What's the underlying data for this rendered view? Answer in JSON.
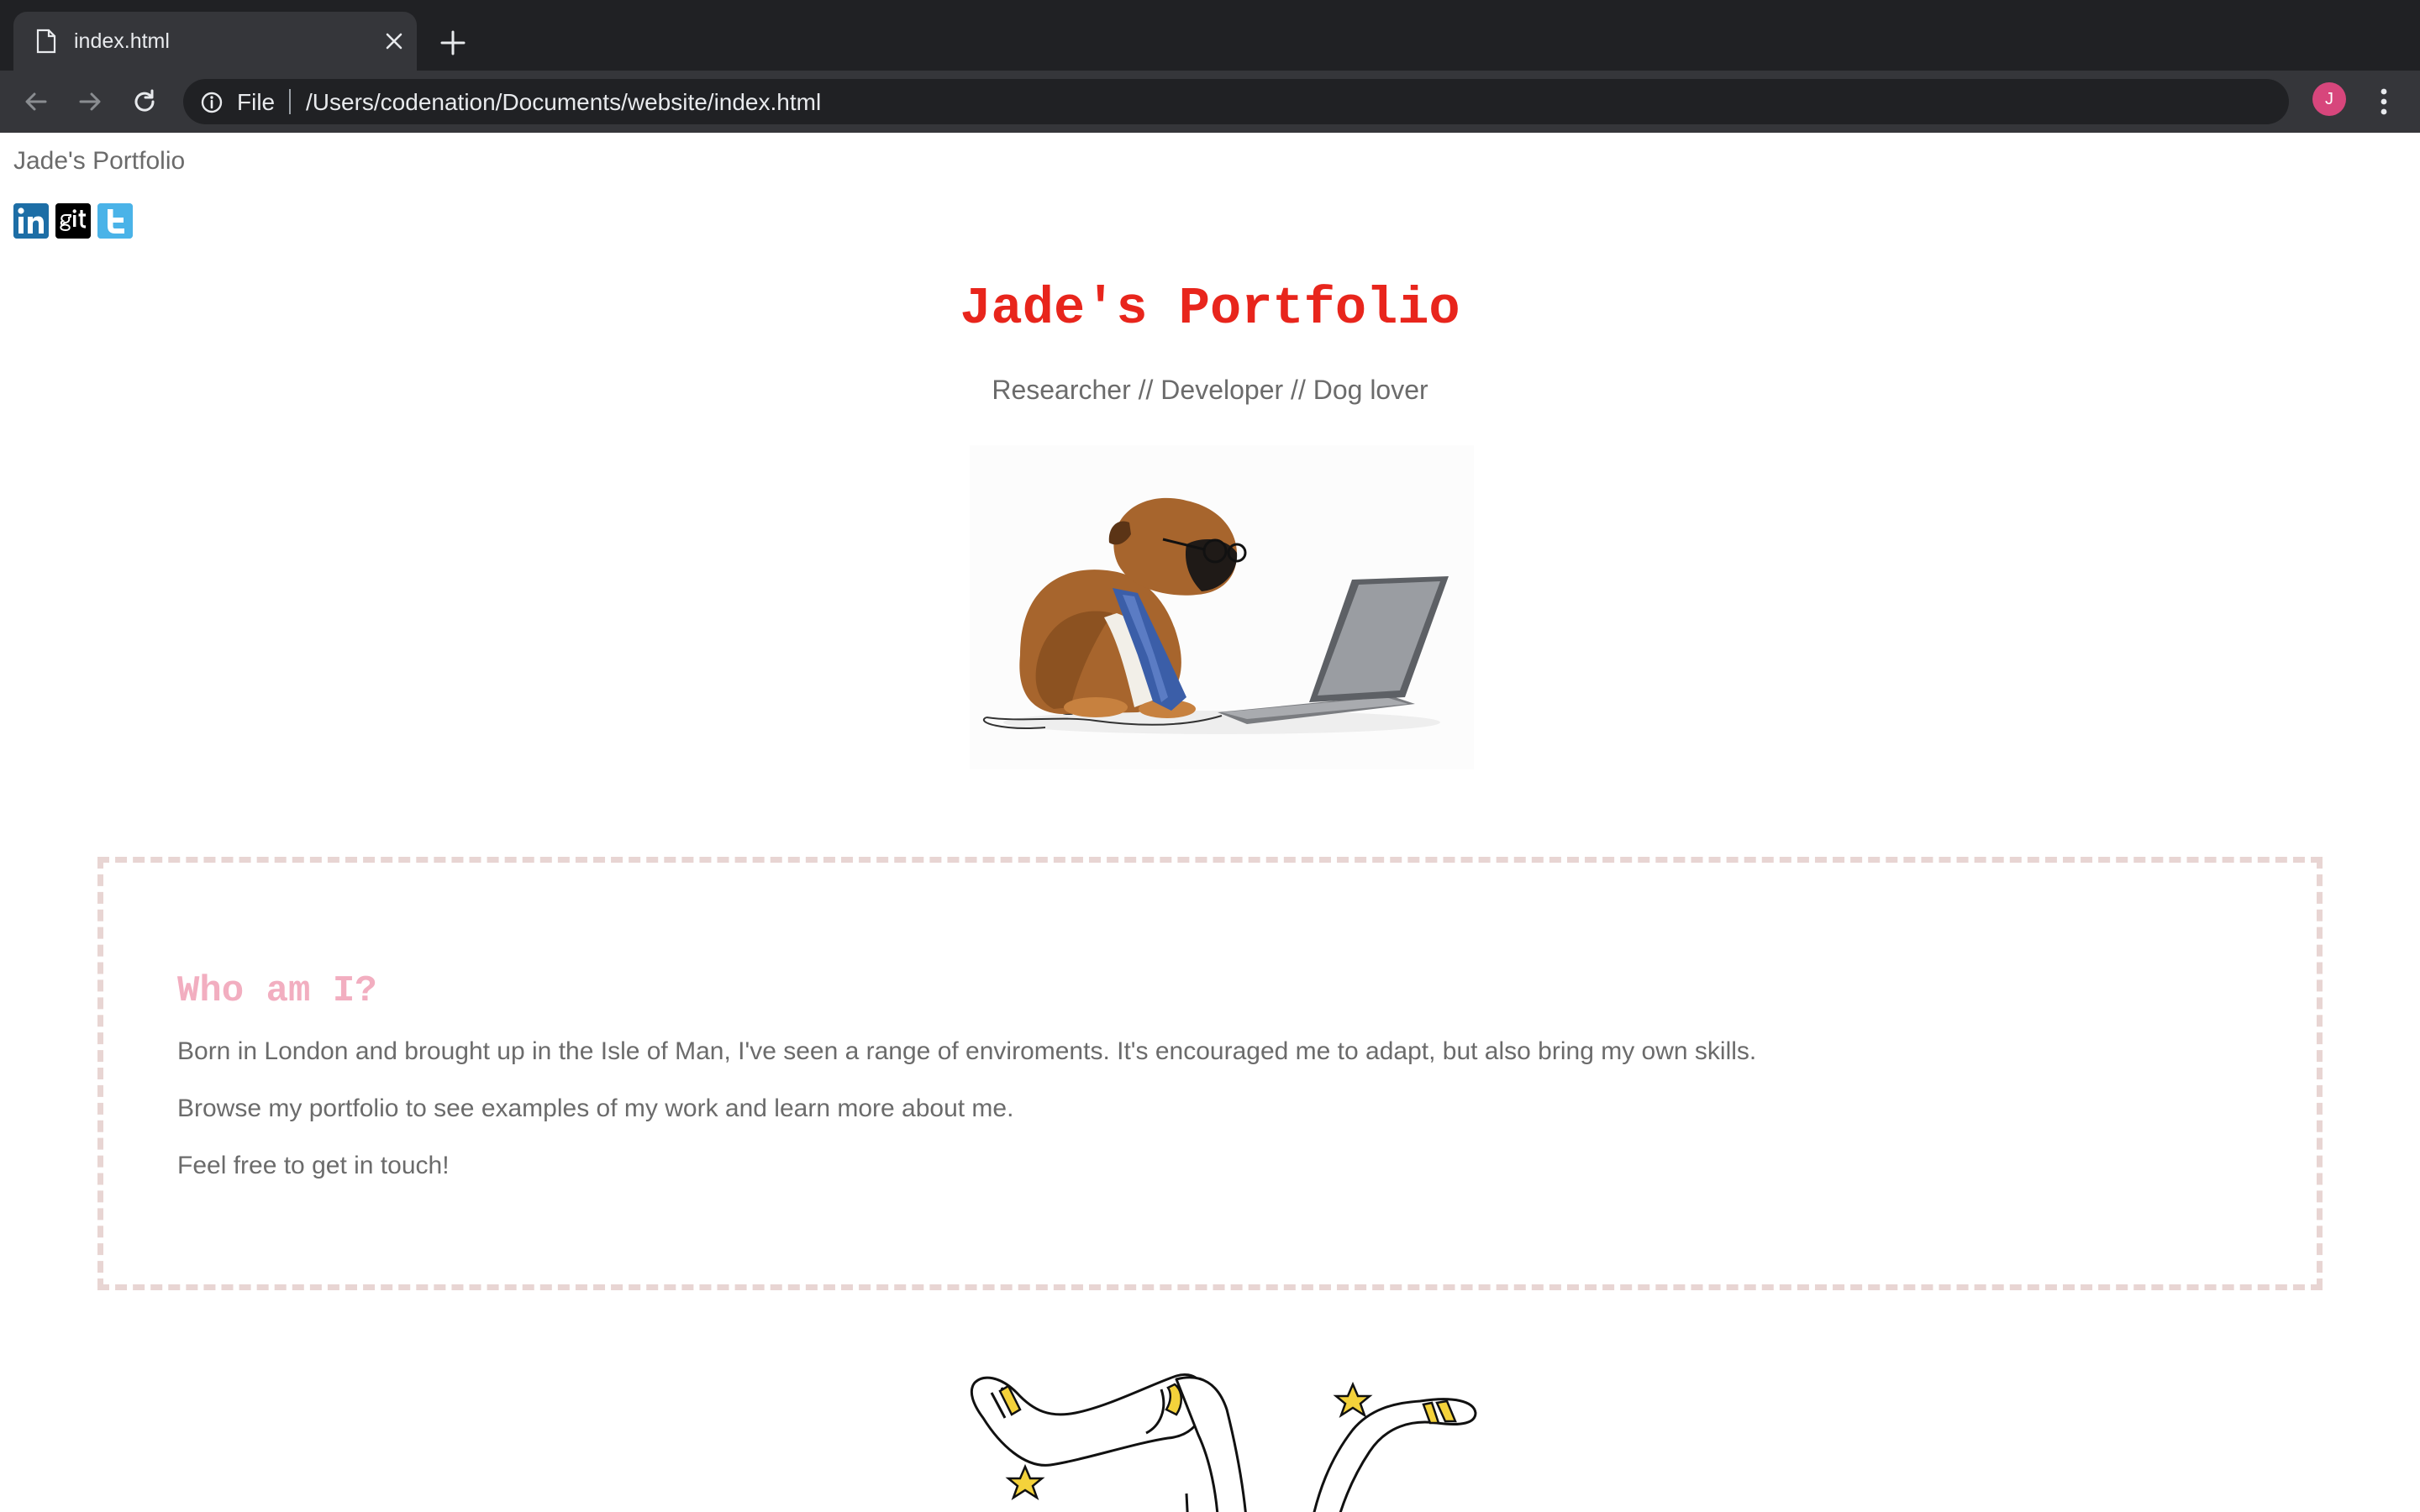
{
  "browser": {
    "tab": {
      "title": "index.html",
      "icon": "page-icon"
    },
    "new_tab_icon": "plus-icon",
    "toolbar": {
      "back_icon": "arrow-left-icon",
      "forward_icon": "arrow-right-icon",
      "reload_icon": "reload-icon",
      "scheme_label": "File",
      "url": "/Users/codenation/Documents/website/index.html",
      "bookmark_icon": "star-icon",
      "profile_initial": "J",
      "menu_icon": "kebab-menu-icon"
    },
    "colors": {
      "tabbar": "#202124",
      "toolbar": "#35363a",
      "omnibox": "#202124",
      "avatar": "#d7467c"
    }
  },
  "page": {
    "nav_title": "Jade's Portfolio",
    "socials": [
      {
        "label": "in",
        "icon": "linkedin-icon"
      },
      {
        "label": "git",
        "icon": "git-icon"
      },
      {
        "label": "twitter",
        "icon": "twitter-icon"
      }
    ],
    "hero": {
      "title": "Jade's Portfolio",
      "subtitle": "Researcher // Developer // Dog lover"
    },
    "about": {
      "heading": "Who am I?",
      "paragraphs": [
        "Born in London and brought up in the Isle of Man, I've seen a range of enviroments. It's encouraged me to adapt, but also bring my own skills.",
        "Browse my portfolio to see examples of my work and learn more about me.",
        "Feel free to get in touch!"
      ]
    },
    "colors": {
      "title": "#e8251c",
      "heading": "#f2aec0",
      "text": "#6b6b6b",
      "border": "#e8d5d3"
    }
  }
}
